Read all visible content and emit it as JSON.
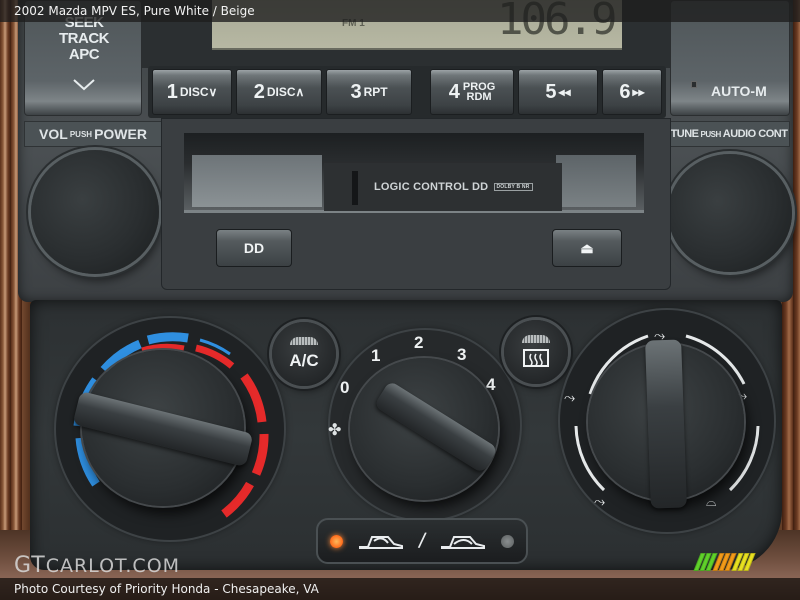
{
  "header": {
    "title": "2002 Mazda MPV ES,  Pure White / Beige"
  },
  "radio": {
    "seek_button": {
      "lines": [
        "SEEK",
        "TRACK",
        "APC"
      ],
      "icon": "chevron-down-icon"
    },
    "auto_m_button": {
      "label": "AUTO-M"
    },
    "display": {
      "band": "FM 1",
      "frequency": "106.9"
    },
    "presets": [
      {
        "number": "1",
        "label": "DISC∨"
      },
      {
        "number": "2",
        "label": "DISC∧"
      },
      {
        "number": "3",
        "label": "RPT"
      },
      {
        "number": "4",
        "label_top": "PROG",
        "label_bottom": "RDM"
      },
      {
        "number": "5",
        "label": "◂◂"
      },
      {
        "number": "6",
        "label": "▸▸"
      }
    ],
    "vol_knob": {
      "label_main": "VOL",
      "label_small": "PUSH",
      "label_end": "POWER"
    },
    "tune_knob": {
      "label_main": "TUNE",
      "label_small": "PUSH",
      "label_end": "AUDIO CONT"
    },
    "cassette": {
      "door_text": "LOGIC CONTROL",
      "dolby_mark": "DD",
      "dolby_badge": "DOLBY B NR",
      "dolby_button_label": "DD",
      "eject_button_label": "⏏"
    }
  },
  "climate": {
    "temperature_dial": {
      "cold_color": "#2f8fe0",
      "hot_color": "#e52a2a"
    },
    "fan_dial": {
      "positions": [
        "0",
        "1",
        "2",
        "3",
        "4"
      ],
      "icon": "fan-icon"
    },
    "ac_button": {
      "label": "A/C"
    },
    "rear_defrost_button": {
      "icon": "rear-defrost-icon"
    },
    "mode_dial": {
      "icons": [
        "vent-face-icon",
        "bi-level-icon",
        "floor-icon",
        "floor-defrost-icon",
        "defrost-icon"
      ]
    },
    "recirculation": {
      "fresh_led": "on",
      "recirc_led": "off",
      "separator": "/"
    }
  },
  "watermark": {
    "brand_gt": "GT",
    "brand_rest": "CARLOT.COM"
  },
  "footer": {
    "credit": "Photo Courtesy of Priority Honda - Chesapeake, VA"
  },
  "rating": {
    "colors": [
      "#5fd12a",
      "#f39a18",
      "#e8e020"
    ]
  }
}
